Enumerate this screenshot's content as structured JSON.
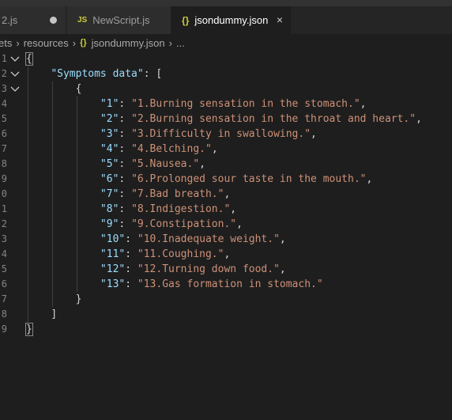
{
  "tabs": [
    {
      "label": "2.js",
      "icon": "js-icon",
      "modified": true
    },
    {
      "label": "NewScript.js",
      "icon": "js-icon",
      "modified": false
    },
    {
      "label": "jsondummy.json",
      "icon": "json-icon",
      "active": true
    }
  ],
  "tab_icons": {
    "js": "JS",
    "json": "{}",
    "close": "×"
  },
  "breadcrumb": [
    "ets",
    "resources",
    "jsondummy.json",
    "..."
  ],
  "line_numbers": [
    "1",
    "2",
    "3",
    "4",
    "5",
    "6",
    "7",
    "8",
    "9",
    "0",
    "1",
    "2",
    "3",
    "4",
    "5",
    "6",
    "7",
    "8",
    "9"
  ],
  "code": {
    "open_brace": "{",
    "root_key": "\"Symptoms data\"",
    "open_array": "[",
    "inner_open": "{",
    "entries": [
      {
        "key": "\"1\"",
        "value": "\"1.Burning sensation in the stomach.\"",
        "comma": ","
      },
      {
        "key": "\"2\"",
        "value": "\"2.Burning sensation in the throat and heart.\"",
        "comma": ","
      },
      {
        "key": "\"3\"",
        "value": "\"3.Difficulty in swallowing.\"",
        "comma": ","
      },
      {
        "key": "\"4\"",
        "value": "\"4.Belching.\"",
        "comma": ","
      },
      {
        "key": "\"5\"",
        "value": "\"5.Nausea.\"",
        "comma": ","
      },
      {
        "key": "\"6\"",
        "value": "\"6.Prolonged sour taste in the mouth.\"",
        "comma": ","
      },
      {
        "key": "\"7\"",
        "value": "\"7.Bad breath.\"",
        "comma": ","
      },
      {
        "key": "\"8\"",
        "value": "\"8.Indigestion.\"",
        "comma": ","
      },
      {
        "key": "\"9\"",
        "value": "\"9.Constipation.\"",
        "comma": ","
      },
      {
        "key": "\"10\"",
        "value": "\"10.Inadequate weight.\"",
        "comma": ","
      },
      {
        "key": "\"11\"",
        "value": "\"11.Coughing.\"",
        "comma": ","
      },
      {
        "key": "\"12\"",
        "value": "\"12.Turning down food.\"",
        "comma": ","
      },
      {
        "key": "\"13\"",
        "value": "\"13.Gas formation in stomach.\"",
        "comma": ""
      }
    ],
    "inner_close": "}",
    "close_array": "]",
    "close_brace": "}"
  },
  "colors": {
    "background": "#1e1e1e",
    "key": "#9cdcfe",
    "string": "#ce9178",
    "punctuation": "#d4d4d4",
    "line_number": "#858585",
    "json_icon": "#cbcb41"
  }
}
